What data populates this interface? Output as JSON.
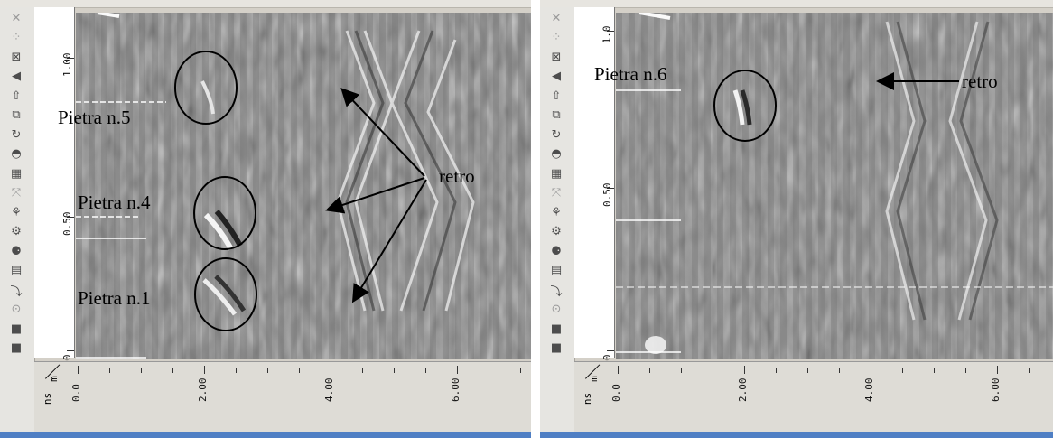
{
  "colors": {
    "background": "#d4d0c8",
    "radar_gray": "#8a8a8a",
    "title_bar": "#4f7fc4"
  },
  "toolbar_icons": [
    "close-icon",
    "select-icon",
    "zoom-icon",
    "back-icon",
    "up-icon",
    "copy-icon",
    "refresh-icon",
    "sphere-icon",
    "spread-icon",
    "fit-icon",
    "wiggle-icon",
    "gain-icon",
    "marker-icon",
    "grid-icon",
    "pick-icon",
    "circle-icon",
    "layer-icon",
    "stop-icon"
  ],
  "panels": [
    {
      "y_axis": {
        "labels": [
          "1.00",
          "0.50",
          "00"
        ]
      },
      "x_axis": {
        "unit_top": "m",
        "unit_bottom": "ns",
        "labels": [
          "0.0",
          "2.00",
          "4.00",
          "6.00"
        ]
      },
      "annotations": {
        "stone5": "Pietra n.5",
        "stone4": "Pietra n.4",
        "stone1": "Pietra n.1",
        "retro": "retro"
      }
    },
    {
      "y_axis": {
        "labels": [
          "1.0",
          "0.50",
          "00"
        ]
      },
      "x_axis": {
        "unit_top": "m",
        "unit_bottom": "ns",
        "labels": [
          "0.0",
          "2.00",
          "4.00",
          "6.00"
        ]
      },
      "annotations": {
        "stone6": "Pietra n.6",
        "retro": "retro"
      }
    }
  ]
}
